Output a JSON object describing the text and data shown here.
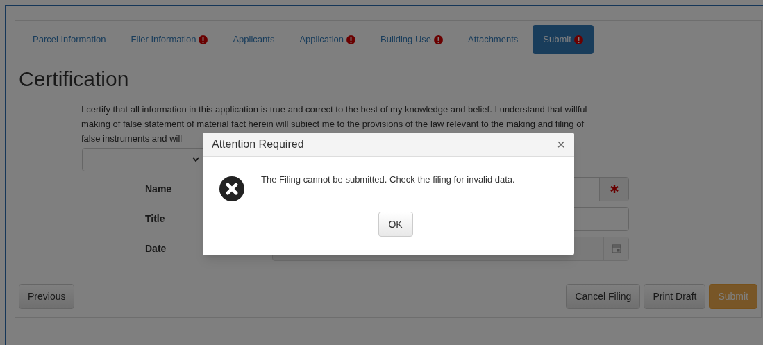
{
  "tabs": [
    {
      "label": "Parcel Information",
      "alert": false,
      "selected": false
    },
    {
      "label": "Filer Information",
      "alert": true,
      "selected": false
    },
    {
      "label": "Applicants",
      "alert": false,
      "selected": false
    },
    {
      "label": "Application",
      "alert": true,
      "selected": false
    },
    {
      "label": "Building Use",
      "alert": true,
      "selected": false
    },
    {
      "label": "Attachments",
      "alert": false,
      "selected": false
    },
    {
      "label": "Submit",
      "alert": true,
      "selected": true
    }
  ],
  "heading": "Certification",
  "statement_lines": [
    "I certify that all information in this application is true and correct to the best of my knowledge and belief. I understand that willful",
    "making of false statement of material fact herein will subiect me to the provisions of the law relevant to the making and filing of",
    "false instruments and will"
  ],
  "fields": [
    {
      "label": "Name",
      "kind": "required"
    },
    {
      "label": "Title",
      "kind": "text"
    },
    {
      "label": "Date",
      "kind": "date"
    }
  ],
  "footer": {
    "left": [
      {
        "label": "Previous",
        "kind": "default"
      }
    ],
    "right": [
      {
        "label": "Cancel Filing",
        "kind": "default"
      },
      {
        "label": "Print Draft",
        "kind": "default"
      },
      {
        "label": "Submit",
        "kind": "primary"
      }
    ]
  },
  "dialog": {
    "title": "Attention Required",
    "close": "×",
    "message": "The Filing cannot be submitted. Check the filing for invalid data.",
    "button": "OK"
  }
}
